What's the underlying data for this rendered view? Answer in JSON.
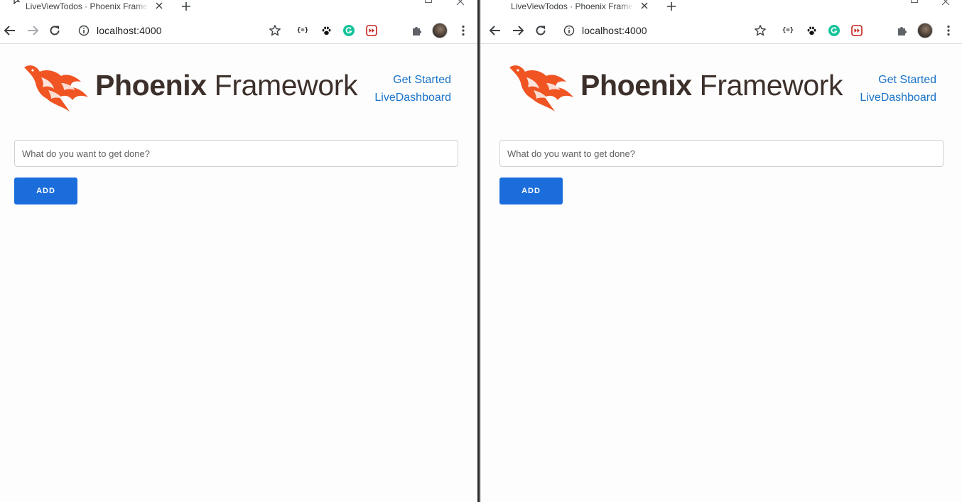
{
  "browser": {
    "tab_title": "LiveViewTodos · Phoenix Framework",
    "url": "localhost:4000",
    "extensions": [
      "json-viewer-icon",
      "paw-icon",
      "grammarly-icon",
      "red-forward-icon"
    ]
  },
  "page": {
    "brand": {
      "strong": "Phoenix",
      "light": " Framework"
    },
    "nav": {
      "get_started": "Get Started",
      "live_dashboard": "LiveDashboard"
    },
    "input_placeholder": "What do you want to get done?",
    "add_label": "ADD"
  },
  "colors": {
    "accent": "#1b6ddc",
    "link": "#1a73c8",
    "phoenix_orange": "#f05423",
    "brand_text": "#3d302b"
  }
}
